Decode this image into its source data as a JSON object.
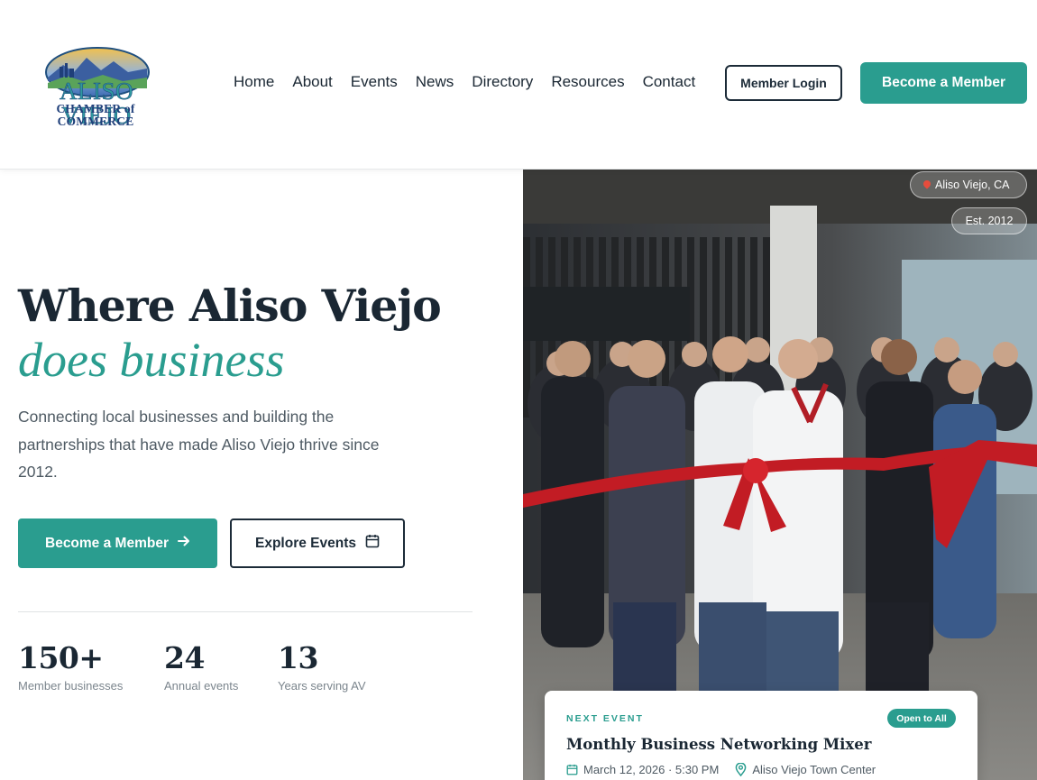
{
  "logo": {
    "line1": "ALISO VIEJO",
    "line2": "CHAMBER of COMMERCE"
  },
  "nav": {
    "items": [
      "Home",
      "About",
      "Events",
      "News",
      "Directory",
      "Resources",
      "Contact"
    ],
    "login_label": "Member Login",
    "join_label": "Become a Member"
  },
  "hero": {
    "title": "Where Aliso Viejo",
    "title_emphasis": "does business",
    "description": "Connecting local businesses and building the partnerships that have made Aliso Viejo thrive since 2012.",
    "primary_cta": "Become a Member",
    "secondary_cta": "Explore Events",
    "stats": [
      {
        "value": "150+",
        "label": "Member businesses"
      },
      {
        "value": "24",
        "label": "Annual events"
      },
      {
        "value": "13",
        "label": "Years serving AV"
      }
    ]
  },
  "photo": {
    "location_chip": "Aliso Viejo, CA",
    "established_chip": "Est. 2012"
  },
  "next_event": {
    "label": "NEXT EVENT",
    "badge": "Open to All",
    "title": "Monthly Business Networking Mixer",
    "datetime": "March 12, 2026 · 5:30 PM",
    "location": "Aliso Viejo Town Center"
  },
  "colors": {
    "accent": "#2a9d8f",
    "ink": "#1a2733",
    "muted": "#4e5a63"
  },
  "icons": [
    "arrow-right-icon",
    "calendar-icon",
    "map-pin-icon",
    "location-pin-icon"
  ]
}
